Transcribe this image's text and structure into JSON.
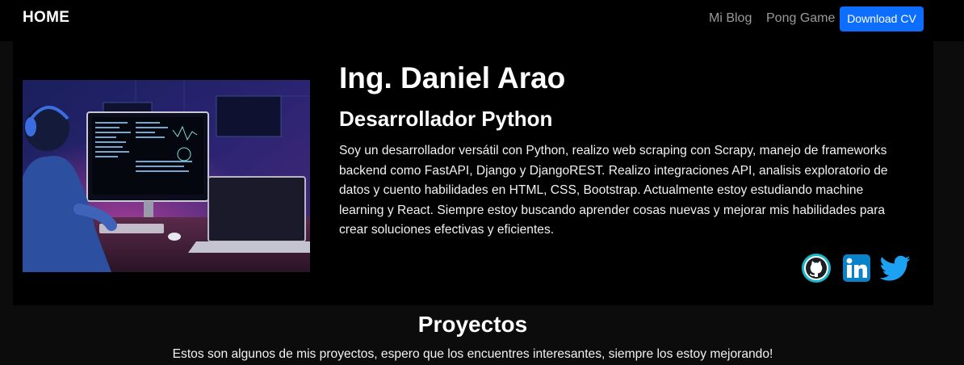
{
  "navbar": {
    "brand": "HOME",
    "links": [
      {
        "label": "Mi Blog"
      },
      {
        "label": "Pong Game"
      }
    ],
    "download_button": "Download CV"
  },
  "hero": {
    "name": "Ing. Daniel Arao",
    "role": "Desarrollador Python",
    "bio": "Soy un desarrollador versátil con Python, realizo web scraping con Scrapy, manejo de frameworks backend como FastAPI, Django y DjangoREST. Realizo integraciones API, analisis exploratorio de datos y cuento habilidades en HTML, CSS, Bootstrap. Actualmente estoy estudiando machine learning y React. Siempre estoy buscando aprender cosas nuevas y mejorar mis habilidades para crear soluciones efectivas y eficientes.",
    "image_icon": "developer-photo",
    "social": [
      {
        "icon": "github-icon",
        "color": "#1ab5c8"
      },
      {
        "icon": "linkedin-icon",
        "color": "#0a82c9"
      },
      {
        "icon": "twitter-icon",
        "color": "#1da1f2"
      }
    ]
  },
  "projects": {
    "title": "Proyectos",
    "subtitle": "Estos son algunos de mis proyectos, espero que los encuentres interesantes, siempre los estoy mejorando!"
  },
  "colors": {
    "page_bg": "#0c0c0c",
    "panel_bg": "#000000",
    "accent": "#0d6efd",
    "nav_link": "#9a9a9a"
  }
}
